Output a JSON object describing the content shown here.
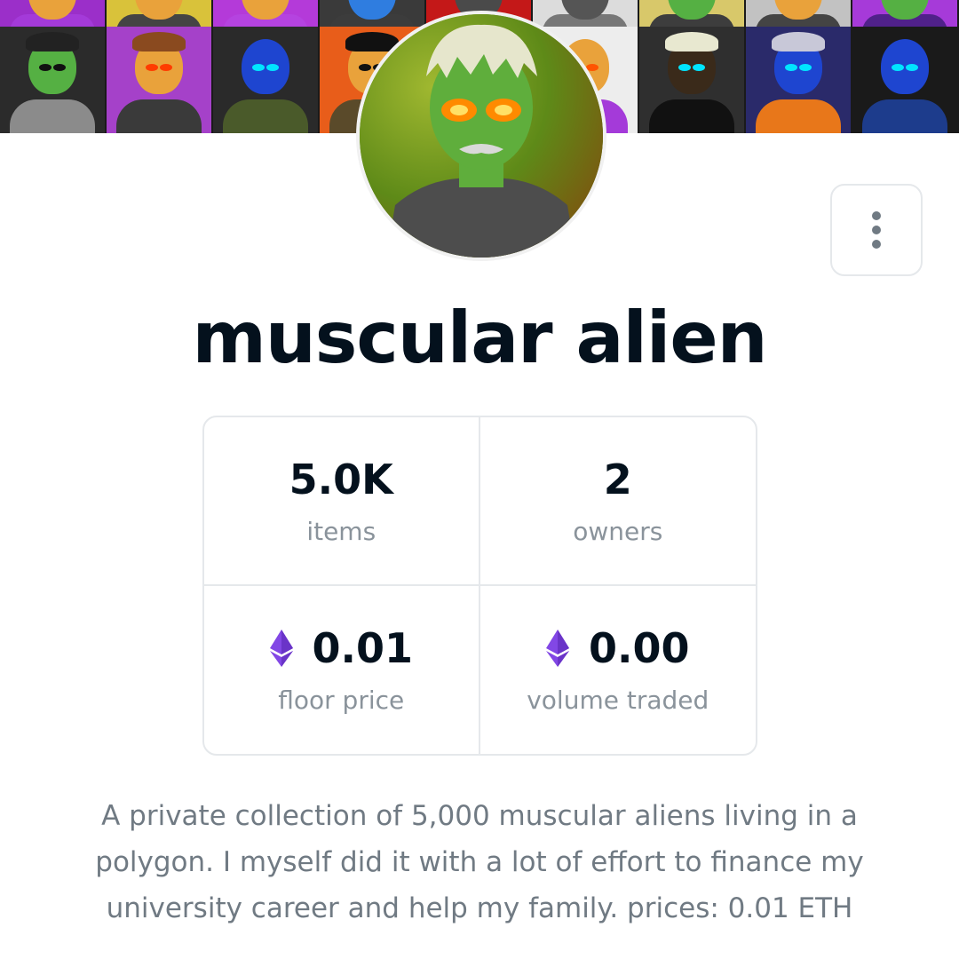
{
  "collection": {
    "name": "muscular alien",
    "description": "A private collection of 5,000 muscular aliens living in a polygon. I myself did it with a lot of effort to finance my university career and help my family. prices: 0.01 ETH"
  },
  "banner": {
    "top_tiles": [
      {
        "bg": "#9b2fc9",
        "skin": "#e9a23b",
        "body": "#a43ad9",
        "eyes": "#ffd23b",
        "hair": ""
      },
      {
        "bg": "#d9c23a",
        "skin": "#e9a23b",
        "body": "#444444",
        "eyes": "#ff6a00",
        "hair": ""
      },
      {
        "bg": "#b43ad9",
        "skin": "#e9a23b",
        "body": "#b543e0",
        "eyes": "#ffd23b",
        "hair": ""
      },
      {
        "bg": "#3a3a3a",
        "skin": "#2f7de0",
        "body": "#3c3c3c",
        "eyes": "#00e5ff",
        "hair": ""
      },
      {
        "bg": "#c41818",
        "skin": "#4a4a4a",
        "body": "#222222",
        "eyes": "#ff5500",
        "hair": ""
      },
      {
        "bg": "#dcdcdc",
        "skin": "#555555",
        "body": "#777777",
        "eyes": "#ffffff",
        "hair": ""
      },
      {
        "bg": "#d8c86a",
        "skin": "#55b043",
        "body": "#3d3d3d",
        "eyes": "#ffd23b",
        "hair": ""
      },
      {
        "bg": "#c2c2c2",
        "skin": "#e9a23b",
        "body": "#444444",
        "eyes": "#ff6a00",
        "hair": ""
      },
      {
        "bg": "#a63ad9",
        "skin": "#55b043",
        "body": "#50218a",
        "eyes": "#ffd23b",
        "hair": ""
      },
      {
        "bg": "#1f8de0",
        "skin": "#2f7de0",
        "body": "#1a1a5e",
        "eyes": "#00e5ff",
        "hair": ""
      }
    ],
    "bottom_tiles": [
      {
        "bg": "#2b2b2b",
        "skin": "#55b043",
        "body": "#8b8b8b",
        "eyes": "#111111",
        "hair": "#222222"
      },
      {
        "bg": "#a541c9",
        "skin": "#e9a23b",
        "body": "#3a3a3a",
        "eyes": "#ff3c00",
        "hair": "#8a4a1f"
      },
      {
        "bg": "#2a2a2a",
        "skin": "#1e45d0",
        "body": "#4a5a2a",
        "eyes": "#00e5ff",
        "hair": ""
      },
      {
        "bg": "#e85d1a",
        "skin": "#e9a23b",
        "body": "#5a4a2a",
        "eyes": "#111111",
        "hair": "#111111"
      },
      {
        "bg": "#333333",
        "skin": "#1e45d0",
        "body": "#3b3b3b",
        "eyes": "#00e5ff",
        "hair": ""
      },
      {
        "bg": "#ededed",
        "skin": "#e9a23b",
        "body": "#a43ad9",
        "eyes": "#ff5500",
        "hair": ""
      },
      {
        "bg": "#2f2f2f",
        "skin": "#3a2a1a",
        "body": "#111111",
        "eyes": "#00e5ff",
        "hair": "#e8e8d0"
      },
      {
        "bg": "#2a2a6a",
        "skin": "#1e45d0",
        "body": "#e8771a",
        "eyes": "#00e5ff",
        "hair": "#c8c8d8"
      },
      {
        "bg": "#1a1a1a",
        "skin": "#1e45d0",
        "body": "#1d3c8c",
        "eyes": "#00e5ff",
        "hair": ""
      },
      {
        "bg": "#3a3a3a",
        "skin": "#55b043",
        "body": "#444444",
        "eyes": "#ffd23b",
        "hair": ""
      }
    ]
  },
  "avatar": {
    "icon": "alien-avatar-icon",
    "skin": "#5fae3c",
    "hair": "#e6e6cc",
    "eyes": "#ff8a00",
    "shirt": "#4d4d4d"
  },
  "menu_button": {
    "icon": "more-vertical-icon"
  },
  "stats": [
    {
      "value": "5.0K",
      "label": "items",
      "icon": ""
    },
    {
      "value": "2",
      "label": "owners",
      "icon": ""
    },
    {
      "value": "0.01",
      "label": "floor price",
      "icon": "eth-icon"
    },
    {
      "value": "0.00",
      "label": "volume traded",
      "icon": "eth-icon"
    }
  ],
  "colors": {
    "title": "#04111d",
    "muted_text": "#707a83",
    "label_text": "#8a939b",
    "border": "#e5e8eb",
    "eth_purple": "#8247e5"
  }
}
